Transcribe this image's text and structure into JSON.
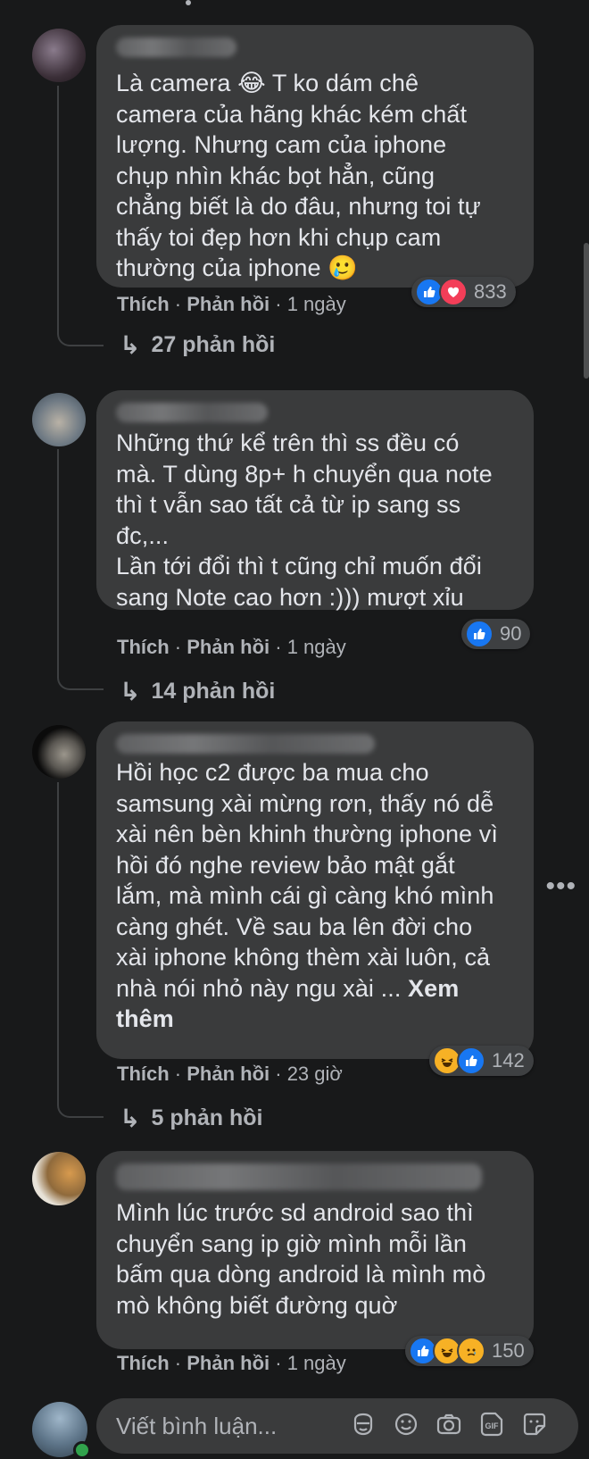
{
  "comments": [
    {
      "text": "Là camera 😂 T ko dám chê\ncamera của hãng khác kém chất\nlượng. Nhưng cam của iphone\nchụp nhìn khác bọt hẳn, cũng\nchẳng biết là do đâu, nhưng toi tự\nthấy toi đẹp hơn khi chụp cam\nthường của iphone 🥲",
      "like_label": "Thích",
      "reply_label": "Phản hồi",
      "time": "1 ngày",
      "reaction_count": "833",
      "reactions": [
        "like",
        "love"
      ],
      "replies_label": "27 phản hồi"
    },
    {
      "text": "Những thứ kể trên thì ss đều có\nmà. T dùng 8p+ h chuyển qua note\nthì t vẫn sao tất cả từ ip sang ss\nđc,...\nLần tới đổi thì t cũng chỉ muốn đổi\nsang Note cao hơn :))) mượt xỉu",
      "like_label": "Thích",
      "reply_label": "Phản hồi",
      "time": "1 ngày",
      "reaction_count": "90",
      "reactions": [
        "like"
      ],
      "replies_label": "14 phản hồi"
    },
    {
      "text": "Hồi học c2 được ba mua cho\nsamsung xài mừng rơn, thấy nó dễ\nxài nên bèn khinh thường iphone vì\nhồi đó nghe review bảo mật gắt\nlắm, mà mình cái gì càng khó mình\ncàng ghét. Về sau ba lên đời cho\nxài iphone không thèm xài luôn, cả\nnhà nói nhỏ này ngu xài ... ",
      "see_more": "Xem\nthêm",
      "like_label": "Thích",
      "reply_label": "Phản hồi",
      "time": "23 giờ",
      "reaction_count": "142",
      "reactions": [
        "haha",
        "like"
      ],
      "replies_label": "5 phản hồi"
    },
    {
      "text": "Mình lúc trước sd android sao thì\nchuyển sang ip giờ mình mỗi lần\nbấm qua dòng android là mình mò\nmò không biết đường quờ",
      "like_label": "Thích",
      "reply_label": "Phản hồi",
      "time": "1 ngày",
      "reaction_count": "150",
      "reactions": [
        "like",
        "haha",
        "sad"
      ]
    }
  ],
  "separator": " · ",
  "composer": {
    "placeholder": "Viết bình luận..."
  },
  "icons": {
    "reply_arrow": "↳",
    "more": "•••"
  },
  "colors": {
    "background": "#18191a",
    "bubble": "#3a3b3c",
    "like": "#1877f2",
    "love": "#f33e58",
    "haha": "#f7b125",
    "online": "#31a24c"
  }
}
